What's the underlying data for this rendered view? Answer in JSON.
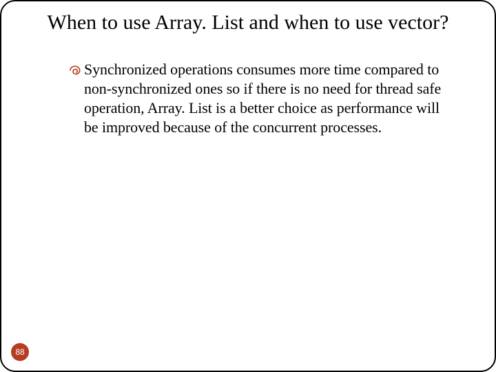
{
  "slide": {
    "title": "When to use Array. List and when to use vector?",
    "bullet_text": "Synchronized operations consumes more time compared to non-synchronized ones so if there is no need for thread safe operation, Array. List is a better choice as performance will be improved because of the concurrent processes.",
    "page_number": "88"
  },
  "colors": {
    "accent": "#b43d24"
  }
}
